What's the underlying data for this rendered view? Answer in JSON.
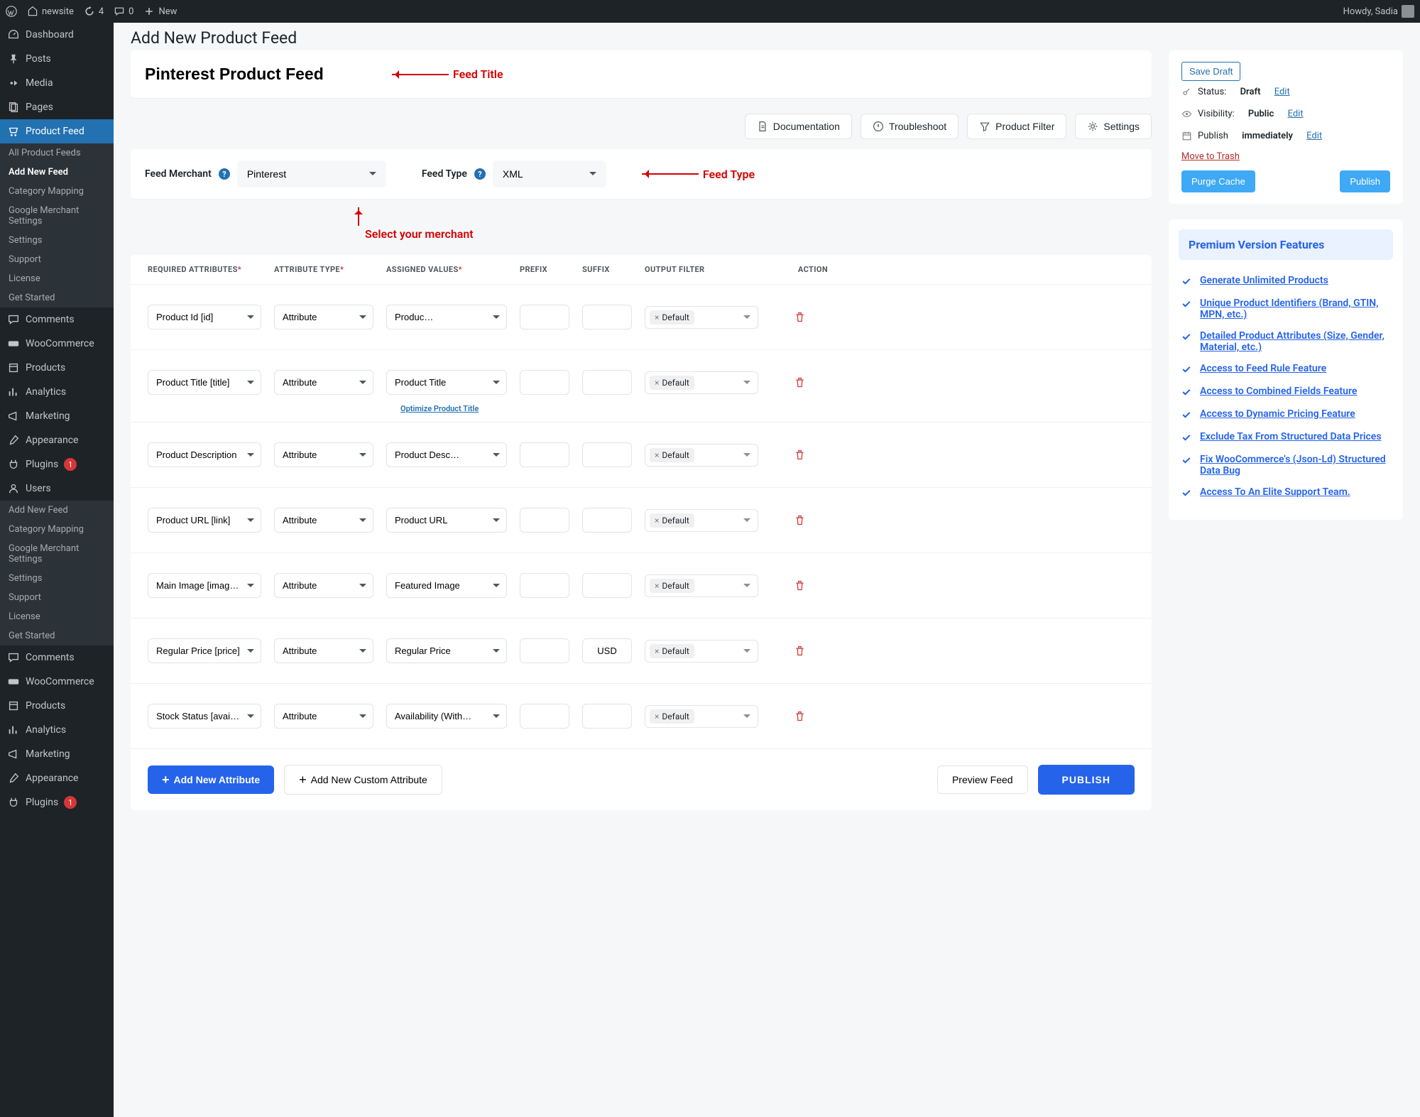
{
  "adminbar": {
    "site_name": "newsite",
    "updates_count": "4",
    "comments_count": "0",
    "new_label": "New",
    "howdy": "Howdy, Sadia"
  },
  "sidenav": {
    "items": [
      {
        "label": "Dashboard",
        "icon": "dashboard"
      },
      {
        "label": "Posts",
        "icon": "pin"
      },
      {
        "label": "Media",
        "icon": "media"
      },
      {
        "label": "Pages",
        "icon": "page"
      },
      {
        "label": "Product Feed",
        "icon": "cart",
        "active": true
      },
      {
        "label": "Comments",
        "icon": "comment"
      },
      {
        "label": "WooCommerce",
        "icon": "woo"
      },
      {
        "label": "Products",
        "icon": "box"
      },
      {
        "label": "Analytics",
        "icon": "chart"
      },
      {
        "label": "Marketing",
        "icon": "mega"
      },
      {
        "label": "Appearance",
        "icon": "brush"
      },
      {
        "label": "Plugins",
        "icon": "plug",
        "badge": "1"
      },
      {
        "label": "Users",
        "icon": "user"
      }
    ],
    "sub1": [
      "All Product Feeds",
      "Add New Feed",
      "Category Mapping",
      "Google Merchant Settings",
      "Settings",
      "Support",
      "License",
      "Get Started"
    ],
    "sub2": [
      "Add New Feed",
      "Category Mapping",
      "Google Merchant Settings",
      "Settings",
      "Support",
      "License",
      "Get Started"
    ],
    "sub2_lower": [
      "Comments",
      "WooCommerce",
      "Products",
      "Analytics",
      "Marketing",
      "Appearance",
      "Plugins"
    ]
  },
  "page": {
    "title": "Add New Product Feed",
    "feed_title_value": "Pinterest Product Feed",
    "anno_feed_title": "Feed Title",
    "anno_feed_type": "Feed Type",
    "anno_merchant": "Select your merchant"
  },
  "toolbar": {
    "documentation": "Documentation",
    "troubleshoot": "Troubleshoot",
    "product_filter": "Product Filter",
    "settings": "Settings"
  },
  "merchant": {
    "merchant_label": "Feed Merchant",
    "merchant_value": "Pinterest",
    "type_label": "Feed Type",
    "type_value": "XML"
  },
  "table": {
    "headers": {
      "required": "REQUIRED ATTRIBUTES",
      "attr_type": "ATTRIBUTE TYPE",
      "assigned": "ASSIGNED VALUES",
      "prefix": "PREFIX",
      "suffix": "SUFFIX",
      "output": "OUTPUT FILTER",
      "action": "ACTION"
    },
    "optimize_link": "Optimize Product Title",
    "rows": [
      {
        "required": "Product Id [id]",
        "type": "Attribute",
        "assigned": "Produc…",
        "prefix": "",
        "suffix": "",
        "filter": "Default"
      },
      {
        "required": "Product Title [title]",
        "type": "Attribute",
        "assigned": "Product Title",
        "prefix": "",
        "suffix": "",
        "filter": "Default",
        "optimize": true
      },
      {
        "required": "Product Description",
        "type": "Attribute",
        "assigned": "Product Desc…",
        "prefix": "",
        "suffix": "",
        "filter": "Default"
      },
      {
        "required": "Product URL [link]",
        "type": "Attribute",
        "assigned": "Product URL",
        "prefix": "",
        "suffix": "",
        "filter": "Default"
      },
      {
        "required": "Main Image [image_link]",
        "type": "Attribute",
        "assigned": "Featured Image",
        "prefix": "",
        "suffix": "",
        "filter": "Default"
      },
      {
        "required": "Regular Price [price]",
        "type": "Attribute",
        "assigned": "Regular Price",
        "prefix": "",
        "suffix": "USD",
        "filter": "Default"
      },
      {
        "required": "Stock Status [availability]",
        "type": "Attribute",
        "assigned": "Availability (With…",
        "prefix": "",
        "suffix": "",
        "filter": "Default"
      }
    ]
  },
  "footer_btns": {
    "add_attr": "Add New Attribute",
    "add_custom": "Add New Custom Attribute",
    "preview": "Preview Feed",
    "publish": "PUBLISH"
  },
  "publish_box": {
    "save_draft": "Save Draft",
    "status_label": "Status:",
    "status_value": "Draft",
    "visibility_label": "Visibility:",
    "visibility_value": "Public",
    "sched_label": "Publish",
    "sched_value": "immediately",
    "edit": "Edit",
    "move_trash": "Move to Trash",
    "purge": "Purge Cache",
    "publish": "Publish"
  },
  "premium": {
    "title": "Premium Version Features",
    "items": [
      "Generate Unlimited Products",
      "Unique Product Identifiers (Brand, GTIN, MPN, etc.)",
      "Detailed Product Attributes (Size, Gender, Material, etc.)",
      "Access to Feed Rule Feature",
      "Access to Combined Fields Feature",
      "Access to Dynamic Pricing Feature",
      "Exclude Tax From Structured Data Prices",
      "Fix WooCommerce's (Json-Ld) Structured Data Bug",
      "Access To An Elite Support Team."
    ]
  }
}
